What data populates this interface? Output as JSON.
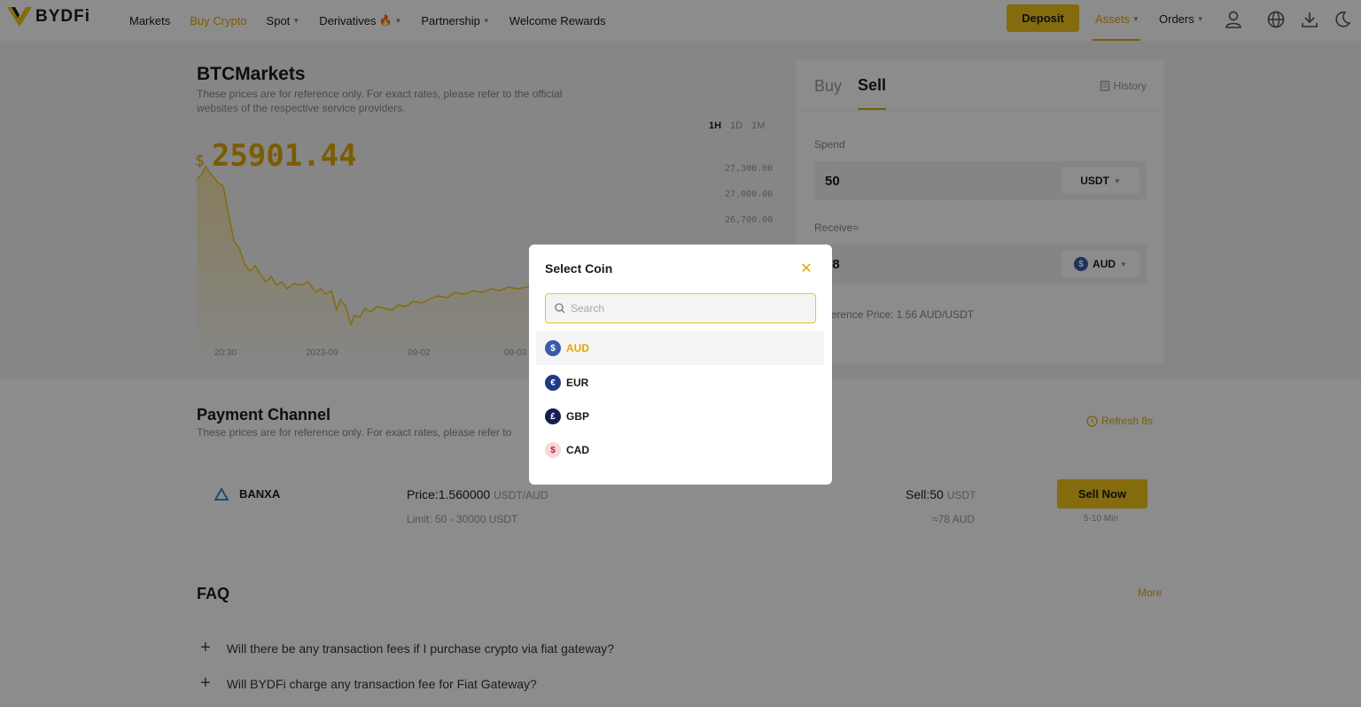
{
  "header": {
    "logo": "BYDFi",
    "nav": [
      {
        "label": "Markets"
      },
      {
        "label": "Buy Crypto"
      },
      {
        "label": "Spot"
      },
      {
        "label": "Derivatives"
      },
      {
        "label": "Partnership"
      },
      {
        "label": "Welcome Rewards"
      }
    ],
    "deposit_label": "Deposit",
    "assets_label": "Assets",
    "orders_label": "Orders"
  },
  "market": {
    "title": "BTCMarkets",
    "subtitle": "These prices are for reference only. For exact rates, please refer to the official websites of the respective service providers.",
    "timeframes": [
      "1H",
      "1D",
      "1M"
    ],
    "currency_symbol": "$",
    "price": "25901.44",
    "yticks": [
      "27,300.00",
      "27,000.00",
      "26,700.00"
    ],
    "xticks": [
      "20:30",
      "2023-09",
      "09-02",
      "09-03"
    ]
  },
  "trade": {
    "tab_buy": "Buy",
    "tab_sell": "Sell",
    "history_label": "History",
    "spend_label": "Spend",
    "spend_value": "50",
    "spend_currency": "USDT",
    "receive_label": "Receive≈",
    "receive_value": "78",
    "receive_currency": "AUD",
    "reference_price": "Reference Price:  1.56 AUD/USDT"
  },
  "payment": {
    "title": "Payment Channel",
    "subtitle": "These prices are for reference only. For exact rates, please refer to",
    "refresh_label": "Refresh 8s",
    "provider": "BANXA",
    "price_label": "Price:1.560000",
    "price_unit": "USDT/AUD",
    "limit": "Limit: 50 - 30000 USDT",
    "sell_label": "Sell:50",
    "sell_unit": "USDT",
    "approx": "≈78 AUD",
    "sell_now": "Sell Now",
    "eta": "5-10 Min"
  },
  "faq": {
    "title": "FAQ",
    "more": "More",
    "questions": [
      "Will there be any transaction fees if I purchase crypto via fiat gateway?",
      "Will BYDFi charge any transaction fee for Fiat Gateway?"
    ]
  },
  "modal": {
    "title": "Select Coin",
    "search_placeholder": "Search",
    "coins": [
      {
        "code": "AUD",
        "symbol": "$",
        "color": "#3b5ba9"
      },
      {
        "code": "EUR",
        "symbol": "€",
        "color": "#1f3a8a"
      },
      {
        "code": "GBP",
        "symbol": "£",
        "color": "#13204f"
      },
      {
        "code": "CAD",
        "symbol": "$",
        "color": "#f4d8da"
      }
    ]
  },
  "colors": {
    "accent": "#f0c419",
    "accent_text": "#e0a800"
  }
}
